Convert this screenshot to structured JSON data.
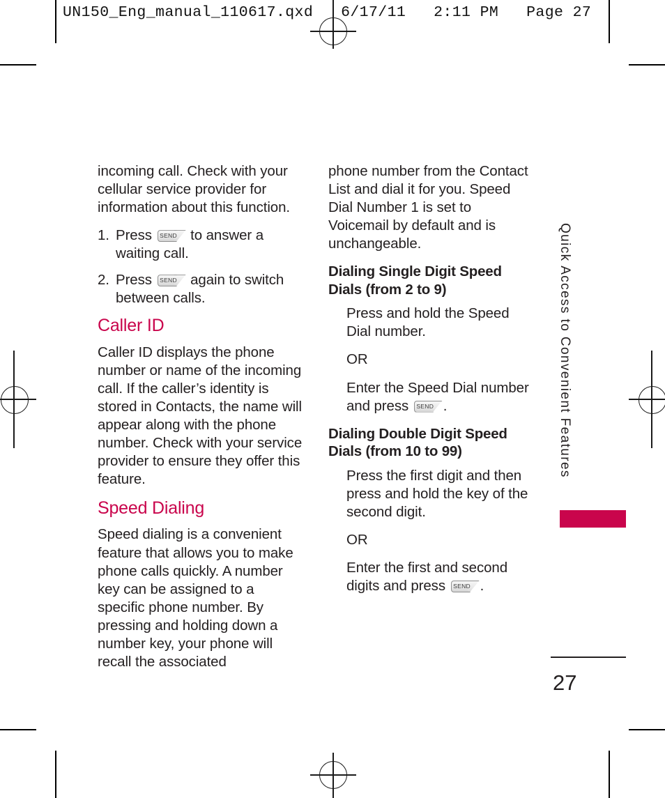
{
  "print_header": "UN150_Eng_manual_110617.qxd   6/17/11   2:11 PM   Page 27",
  "accent_color": "#c9054c",
  "text_color": "#231f20",
  "left_column": {
    "continued_paragraph": "incoming call. Check with your cellular service provider for information about this function.",
    "steps": [
      {
        "num": "1.",
        "before": "Press",
        "key": "SEND",
        "after": "to answer a waiting call."
      },
      {
        "num": "2.",
        "before": "Press",
        "key": "SEND",
        "after": "again to switch between calls."
      }
    ],
    "caller_id": {
      "heading": "Caller ID",
      "body": "Caller ID displays the phone number or name of the incoming call. If the caller’s identity is stored in Contacts, the name will appear along with the phone number. Check with your service provider to ensure they offer this feature."
    },
    "speed_dialing": {
      "heading": "Speed Dialing",
      "body": "Speed dialing is a convenient feature that allows you to make phone calls quickly. A number key can be assigned to a specific phone number. By pressing and holding down a number key, your phone will recall the associated"
    }
  },
  "right_column": {
    "continued_paragraph": "phone number from the Contact List and dial it  for you. Speed Dial Number 1 is set to Voicemail by default and is unchangeable.",
    "single_digit": {
      "heading": "Dialing Single Digit Speed Dials (from 2 to 9)",
      "step1": "Press and hold the Speed Dial number.",
      "or": "OR",
      "step2_before": "Enter the Speed Dial number and press",
      "step2_key": "SEND",
      "step2_after": "."
    },
    "double_digit": {
      "heading": "Dialing Double Digit Speed Dials (from 10 to 99)",
      "step1": "Press the first digit and then press and hold the key of the second digit.",
      "or": "OR",
      "step2_before": "Enter the first and second digits and press",
      "step2_key": "SEND",
      "step2_after": "."
    }
  },
  "side_tab": {
    "label": "Quick Access to Convenient Features"
  },
  "folio": {
    "page_number": "27"
  }
}
